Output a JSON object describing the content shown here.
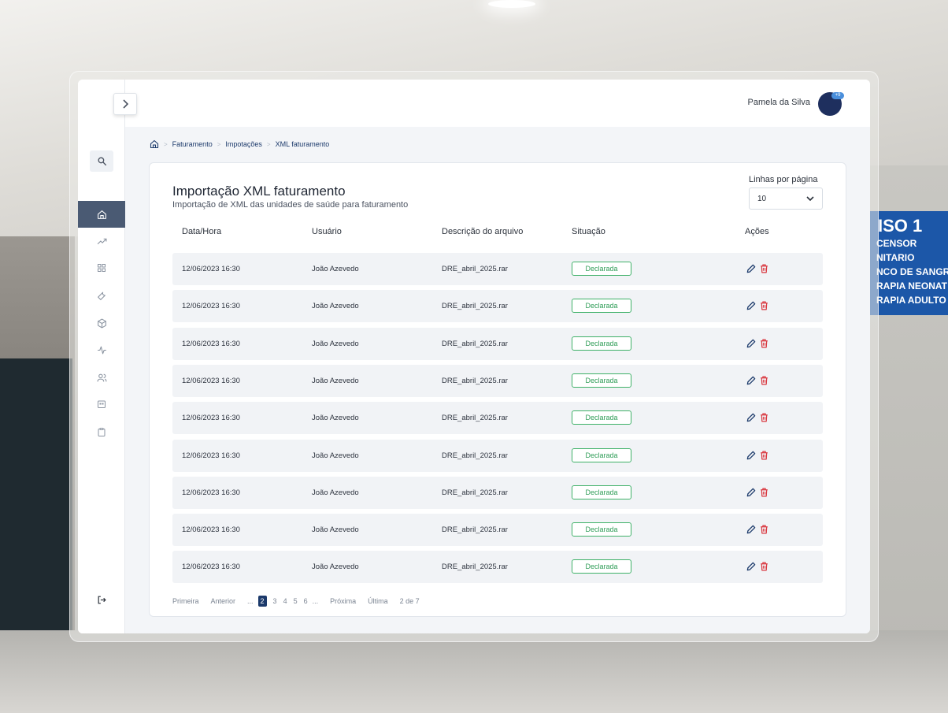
{
  "user": {
    "name": "Pamela da Silva",
    "badge": "+9"
  },
  "breadcrumb": {
    "items": [
      "Faturamento",
      "Impotações",
      "XML faturamento"
    ],
    "separator": ">"
  },
  "page": {
    "title": "Importação XML faturamento",
    "subtitle": "Importação de XML das unidades de saúde para faturamento"
  },
  "rows_per_page": {
    "label": "Linhas por página",
    "value": "10"
  },
  "table": {
    "columns": [
      "Data/Hora",
      "Usuário",
      "Descrição do arquivo",
      "Situação",
      "Ações"
    ],
    "rows": [
      {
        "datetime": "12/06/2023 16:30",
        "user": "João Azevedo",
        "file": "DRE_abril_2025.rar",
        "status": "Declarada"
      },
      {
        "datetime": "12/06/2023 16:30",
        "user": "João Azevedo",
        "file": "DRE_abril_2025.rar",
        "status": "Declarada"
      },
      {
        "datetime": "12/06/2023 16:30",
        "user": "João Azevedo",
        "file": "DRE_abril_2025.rar",
        "status": "Declarada"
      },
      {
        "datetime": "12/06/2023 16:30",
        "user": "João Azevedo",
        "file": "DRE_abril_2025.rar",
        "status": "Declarada"
      },
      {
        "datetime": "12/06/2023 16:30",
        "user": "João Azevedo",
        "file": "DRE_abril_2025.rar",
        "status": "Declarada"
      },
      {
        "datetime": "12/06/2023 16:30",
        "user": "João Azevedo",
        "file": "DRE_abril_2025.rar",
        "status": "Declarada"
      },
      {
        "datetime": "12/06/2023 16:30",
        "user": "João Azevedo",
        "file": "DRE_abril_2025.rar",
        "status": "Declarada"
      },
      {
        "datetime": "12/06/2023 16:30",
        "user": "João Azevedo",
        "file": "DRE_abril_2025.rar",
        "status": "Declarada"
      },
      {
        "datetime": "12/06/2023 16:30",
        "user": "João Azevedo",
        "file": "DRE_abril_2025.rar",
        "status": "Declarada"
      }
    ]
  },
  "pagination": {
    "first": "Primeira",
    "previous": "Anterior",
    "ellipsis": "...",
    "pages": [
      "2",
      "3",
      "4",
      "5",
      "6"
    ],
    "current": "2",
    "next": "Próxima",
    "last": "Última",
    "summary": "2 de 7"
  },
  "sign": {
    "title": "ISO 1",
    "lines": [
      "CENSOR",
      "NITARIO",
      "NCO DE SANGR",
      "RAPIA NEONAT",
      "RAPIA ADULTO"
    ]
  },
  "sidebar": {
    "icons": [
      "home-icon",
      "trending-up-icon",
      "grid-icon",
      "wrench-icon",
      "box-icon",
      "activity-icon",
      "users-icon",
      "calendar-icon",
      "clipboard-icon"
    ]
  },
  "colors": {
    "accent": "#1c3a6b",
    "sidebar_active": "#4a5a73",
    "status_ok": "#2f9d57",
    "delete": "#d9363e"
  }
}
